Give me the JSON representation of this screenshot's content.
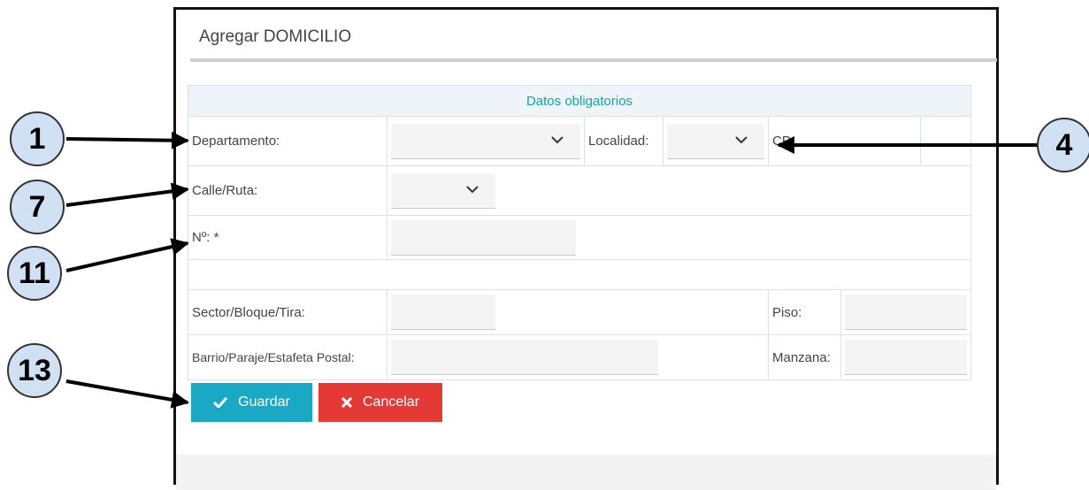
{
  "dialog": {
    "title": "Agregar DOMICILIO"
  },
  "form": {
    "section_header": "Datos obligatorios",
    "departamento_label": "Departamento:",
    "departamento_value": "",
    "localidad_label": "Localidad:",
    "localidad_value": "",
    "cp_label": "CP",
    "calle_label": "Calle/Ruta:",
    "calle_value": "",
    "numero_label": "Nº: *",
    "numero_value": "",
    "sector_label": "Sector/Bloque/Tira:",
    "sector_value": "",
    "piso_label": "Piso:",
    "piso_value": "",
    "barrio_label": "Barrio/Paraje/Estafeta Postal:",
    "barrio_value": "",
    "manzana_label": "Manzana:",
    "manzana_value": ""
  },
  "actions": {
    "save_label": "Guardar",
    "cancel_label": "Cancelar",
    "save_color": "#1aa9c4",
    "cancel_color": "#e53935"
  },
  "callouts": [
    "1",
    "4",
    "7",
    "11",
    "13"
  ],
  "icons": {
    "dropdown": "chevron-down-icon",
    "save": "check-icon",
    "cancel": "x-icon"
  }
}
